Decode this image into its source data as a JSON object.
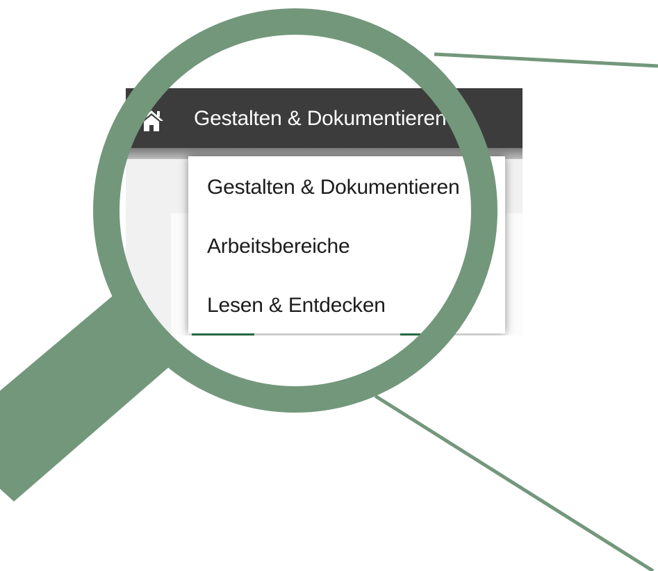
{
  "navbar": {
    "home_icon": "home-icon",
    "menu_label": "Gestalten & Dokumentieren",
    "menu_icon": "chevron-down-icon"
  },
  "dropdown": {
    "items": [
      {
        "label": "Gestalten & Dokumentieren"
      },
      {
        "label": "Arbeitsbereiche"
      },
      {
        "label": "Lesen & Entdecken"
      }
    ]
  },
  "colors": {
    "navbar_bg": "#3c3c3c",
    "magnifier": "#73977b",
    "dropdown_text": "#1c1c1c",
    "nav_text": "#ffffff"
  }
}
